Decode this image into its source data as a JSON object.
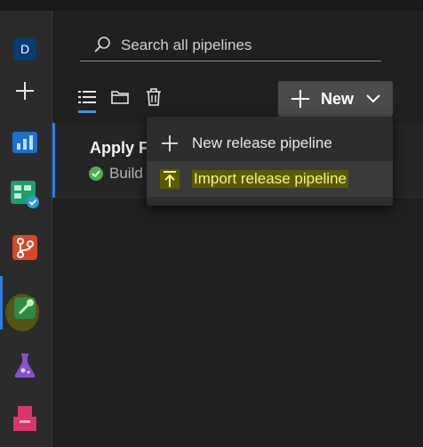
{
  "sidebar": {
    "avatar_letter": "D",
    "items": [
      {
        "icon": "plus-icon"
      },
      {
        "icon": "overview-icon"
      },
      {
        "icon": "boards-icon"
      },
      {
        "icon": "repos-icon"
      },
      {
        "icon": "pipelines-icon"
      },
      {
        "icon": "test-plans-icon"
      },
      {
        "icon": "artifacts-icon"
      }
    ]
  },
  "search": {
    "placeholder": "Search all pipelines"
  },
  "toolbar": {
    "new_label": "New"
  },
  "pipeline_row": {
    "title": "Apply F",
    "subtitle": "Build"
  },
  "menu": {
    "items": [
      {
        "label": "New release pipeline",
        "icon": "plus-icon"
      },
      {
        "label": "Import release pipeline",
        "icon": "upload-icon"
      }
    ]
  },
  "colors": {
    "accent": "#2f7de1",
    "highlight": "#f6f37a"
  }
}
